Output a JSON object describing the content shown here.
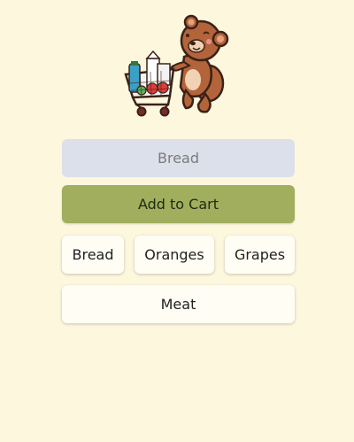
{
  "mascot": {
    "icon": "bear-shopping-cart-icon"
  },
  "item_input": {
    "value": "",
    "placeholder": "Bread"
  },
  "add_button": {
    "label": "Add to Cart",
    "color": "#a0ae5e"
  },
  "suggestions": [
    {
      "label": "Bread"
    },
    {
      "label": "Oranges"
    },
    {
      "label": "Grapes"
    },
    {
      "label": "Meat"
    }
  ],
  "colors": {
    "background": "#fdf7de",
    "input_background": "#dce0ea",
    "chip_background": "#fffdf4"
  }
}
